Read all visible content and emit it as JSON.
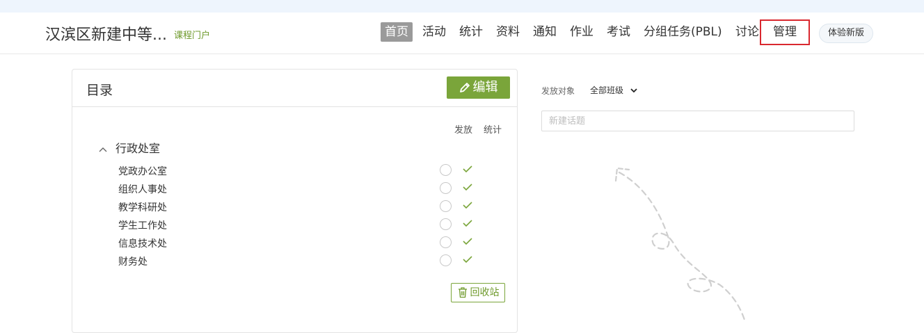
{
  "header": {
    "school_name": "汉滨区新建中等...",
    "portal_label": "课程门户",
    "nav": [
      {
        "label": "首页",
        "active": true
      },
      {
        "label": "活动",
        "active": false
      },
      {
        "label": "统计",
        "active": false
      },
      {
        "label": "资料",
        "active": false
      },
      {
        "label": "通知",
        "active": false
      },
      {
        "label": "作业",
        "active": false
      },
      {
        "label": "考试",
        "active": false
      },
      {
        "label": "分组任务(PBL)",
        "active": false
      },
      {
        "label": "讨论",
        "active": false
      }
    ],
    "manage_label": "管理",
    "try_new_label": "体验新版"
  },
  "directory": {
    "title": "目录",
    "edit_label": "编辑",
    "col_publish": "发放",
    "col_stats": "统计",
    "section_label": "行政处室",
    "items": [
      {
        "label": "党政办公室",
        "published": false,
        "stats": true
      },
      {
        "label": "组织人事处",
        "published": false,
        "stats": true
      },
      {
        "label": "教学科研处",
        "published": false,
        "stats": true
      },
      {
        "label": "学生工作处",
        "published": false,
        "stats": true
      },
      {
        "label": "信息技术处",
        "published": false,
        "stats": true
      },
      {
        "label": "财务处",
        "published": false,
        "stats": true
      }
    ],
    "recycle_label": "回收站"
  },
  "discussion": {
    "target_label": "发放对象",
    "target_value": "全部班级",
    "topic_placeholder": "新建话题"
  },
  "colors": {
    "accent_green": "#7aa53a",
    "highlight_red": "#d9282f",
    "nav_active_bg": "#9a9a9a"
  }
}
